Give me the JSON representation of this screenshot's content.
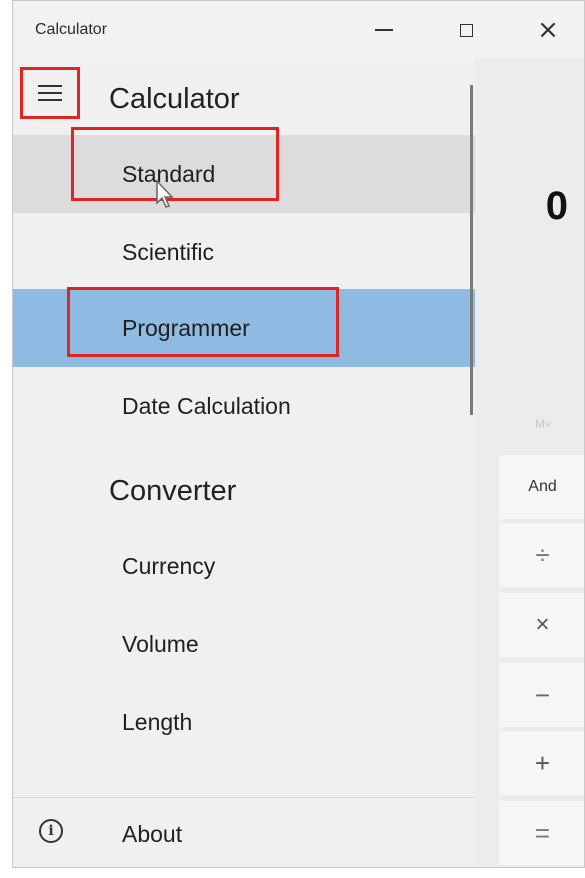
{
  "window": {
    "title": "Calculator",
    "controls": {
      "minimize_icon": "minimize-icon",
      "maximize_icon": "maximize-icon",
      "close_icon": "close-icon",
      "close_glyph": "×"
    }
  },
  "calculator": {
    "display_value": "0",
    "memory_label": "M˅",
    "keys": {
      "and": "And",
      "divide": "÷",
      "multiply": "×",
      "subtract": "−",
      "add": "+",
      "equals": "="
    }
  },
  "drawer": {
    "title": "Calculator",
    "calculator_items": [
      {
        "label": "Standard",
        "state": "hover"
      },
      {
        "label": "Scientific",
        "state": "normal"
      },
      {
        "label": "Programmer",
        "state": "selected"
      },
      {
        "label": "Date Calculation",
        "state": "normal"
      }
    ],
    "converter_title": "Converter",
    "converter_items": [
      {
        "label": "Currency"
      },
      {
        "label": "Volume"
      },
      {
        "label": "Length"
      }
    ],
    "about": {
      "label": "About",
      "icon": "info-icon",
      "glyph": "i"
    }
  },
  "colors": {
    "highlight_red": "#e02424",
    "selected_blue": "#8fbbe3",
    "hover_gray": "#dcdcdc",
    "drawer_bg": "#f0f0f0"
  }
}
